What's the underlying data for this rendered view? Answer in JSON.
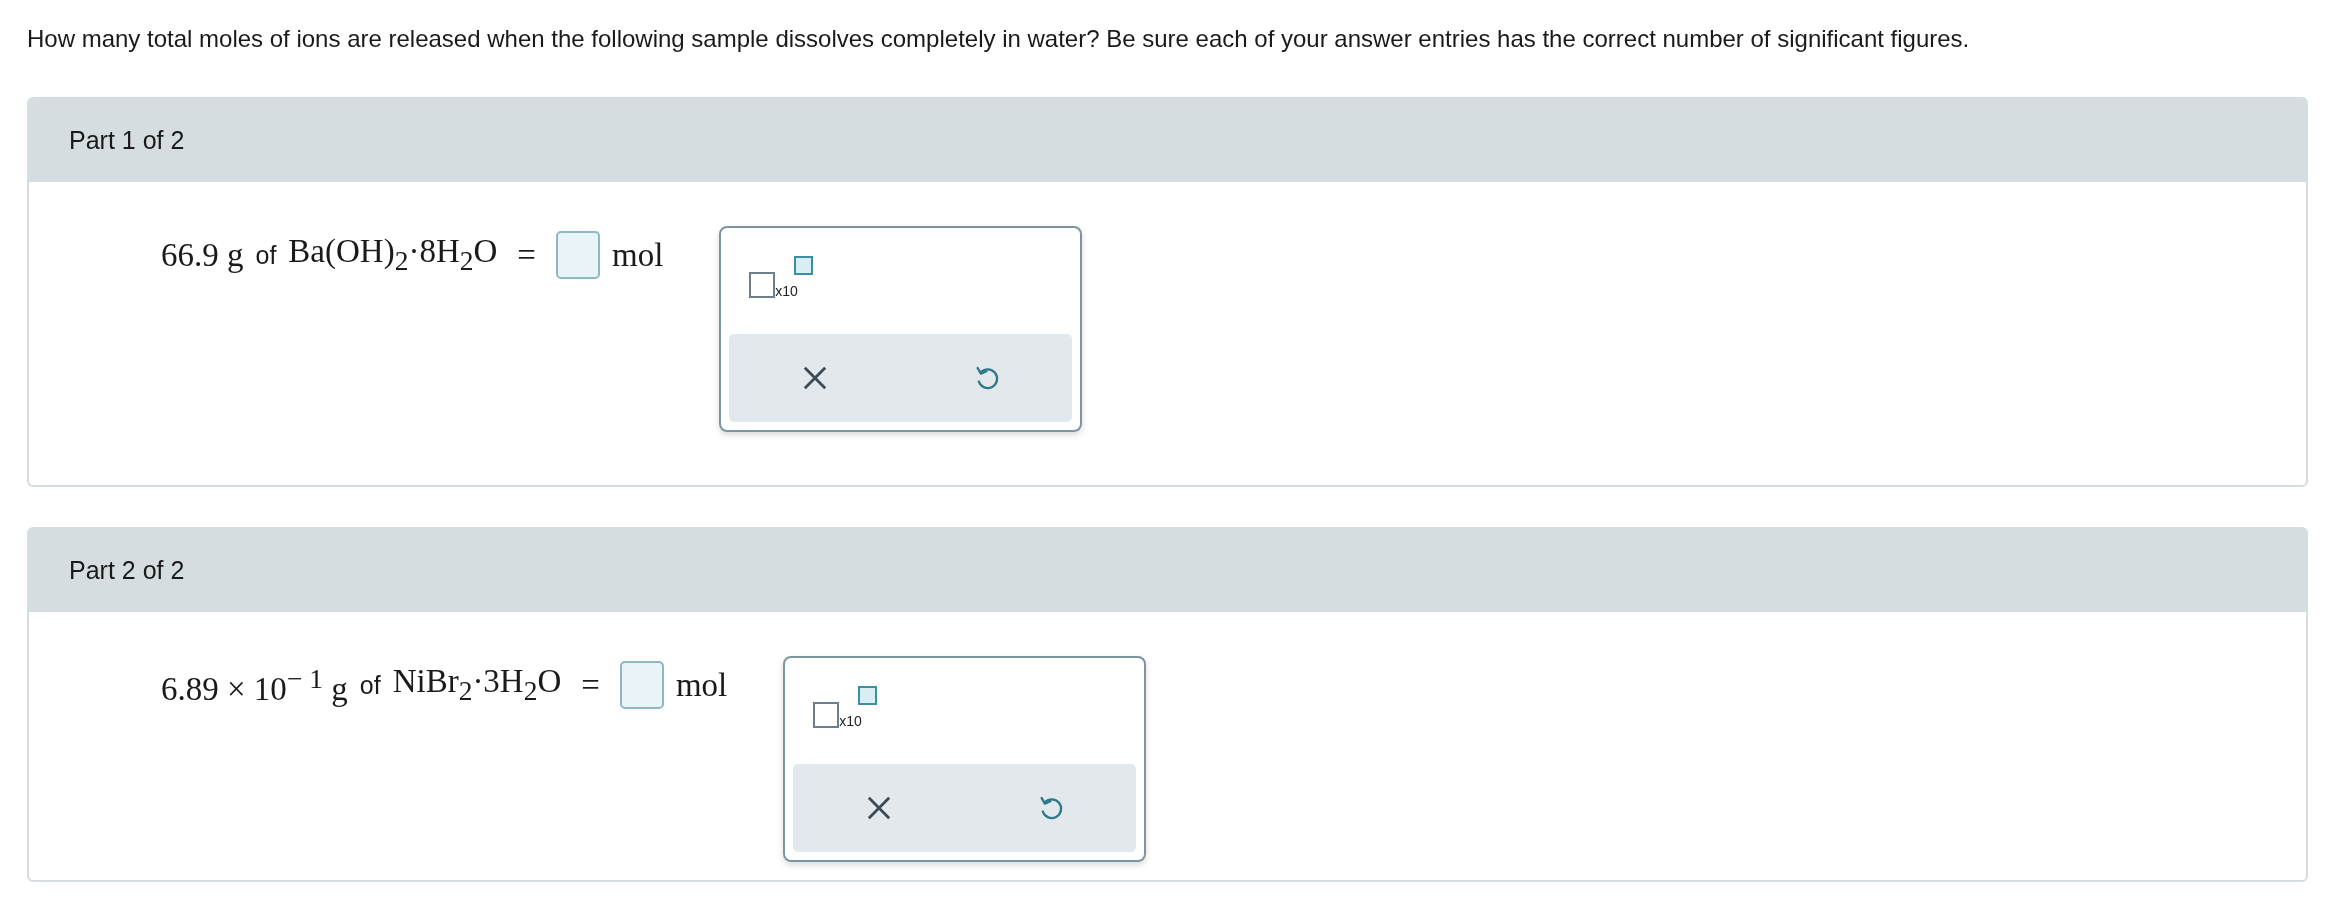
{
  "question": "How many total moles of ions are released when the following sample dissolves completely in water? Be sure each of your answer entries has the correct number of significant figures.",
  "parts": [
    {
      "header": "Part 1 of 2",
      "amount": "66.9 g",
      "connector": "of",
      "formula": "Ba(OH)$_{2}$·8H$_{2}$O",
      "equals": "=",
      "unit": "mol",
      "exponent_label": "x10"
    },
    {
      "header": "Part 2 of 2",
      "amount": "6.89 × 10$^{− 1}$ g",
      "connector": "of",
      "formula": "NiBr$_{2}$·3H$_{2}$O",
      "equals": "=",
      "unit": "mol",
      "exponent_label": "x10"
    }
  ]
}
